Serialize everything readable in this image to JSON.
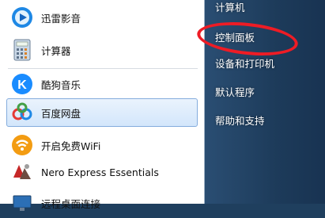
{
  "programs": [
    {
      "label": "迅雷影音",
      "icon": "xunlei-player-icon"
    },
    {
      "label": "计算器",
      "icon": "calculator-icon"
    },
    {
      "label": "酷狗音乐",
      "icon": "kugou-music-icon"
    },
    {
      "label": "百度网盘",
      "icon": "baidu-netdisk-icon",
      "selected": true
    },
    {
      "label": "开启免费WiFi",
      "icon": "free-wifi-icon"
    },
    {
      "label": "Nero Express Essentials",
      "icon": "nero-express-icon"
    },
    {
      "label": "远程桌面连接",
      "icon": "remote-desktop-icon"
    }
  ],
  "right_menu": [
    {
      "label": "计算机"
    },
    {
      "label": "控制面板"
    },
    {
      "label": "设备和打印机"
    },
    {
      "label": "默认程序"
    },
    {
      "label": "帮助和支持"
    }
  ],
  "colors": {
    "annotation": "#ee1c25",
    "selected_bg": "#d3e6fb",
    "right_pane_bg": "#1f3f5e"
  }
}
